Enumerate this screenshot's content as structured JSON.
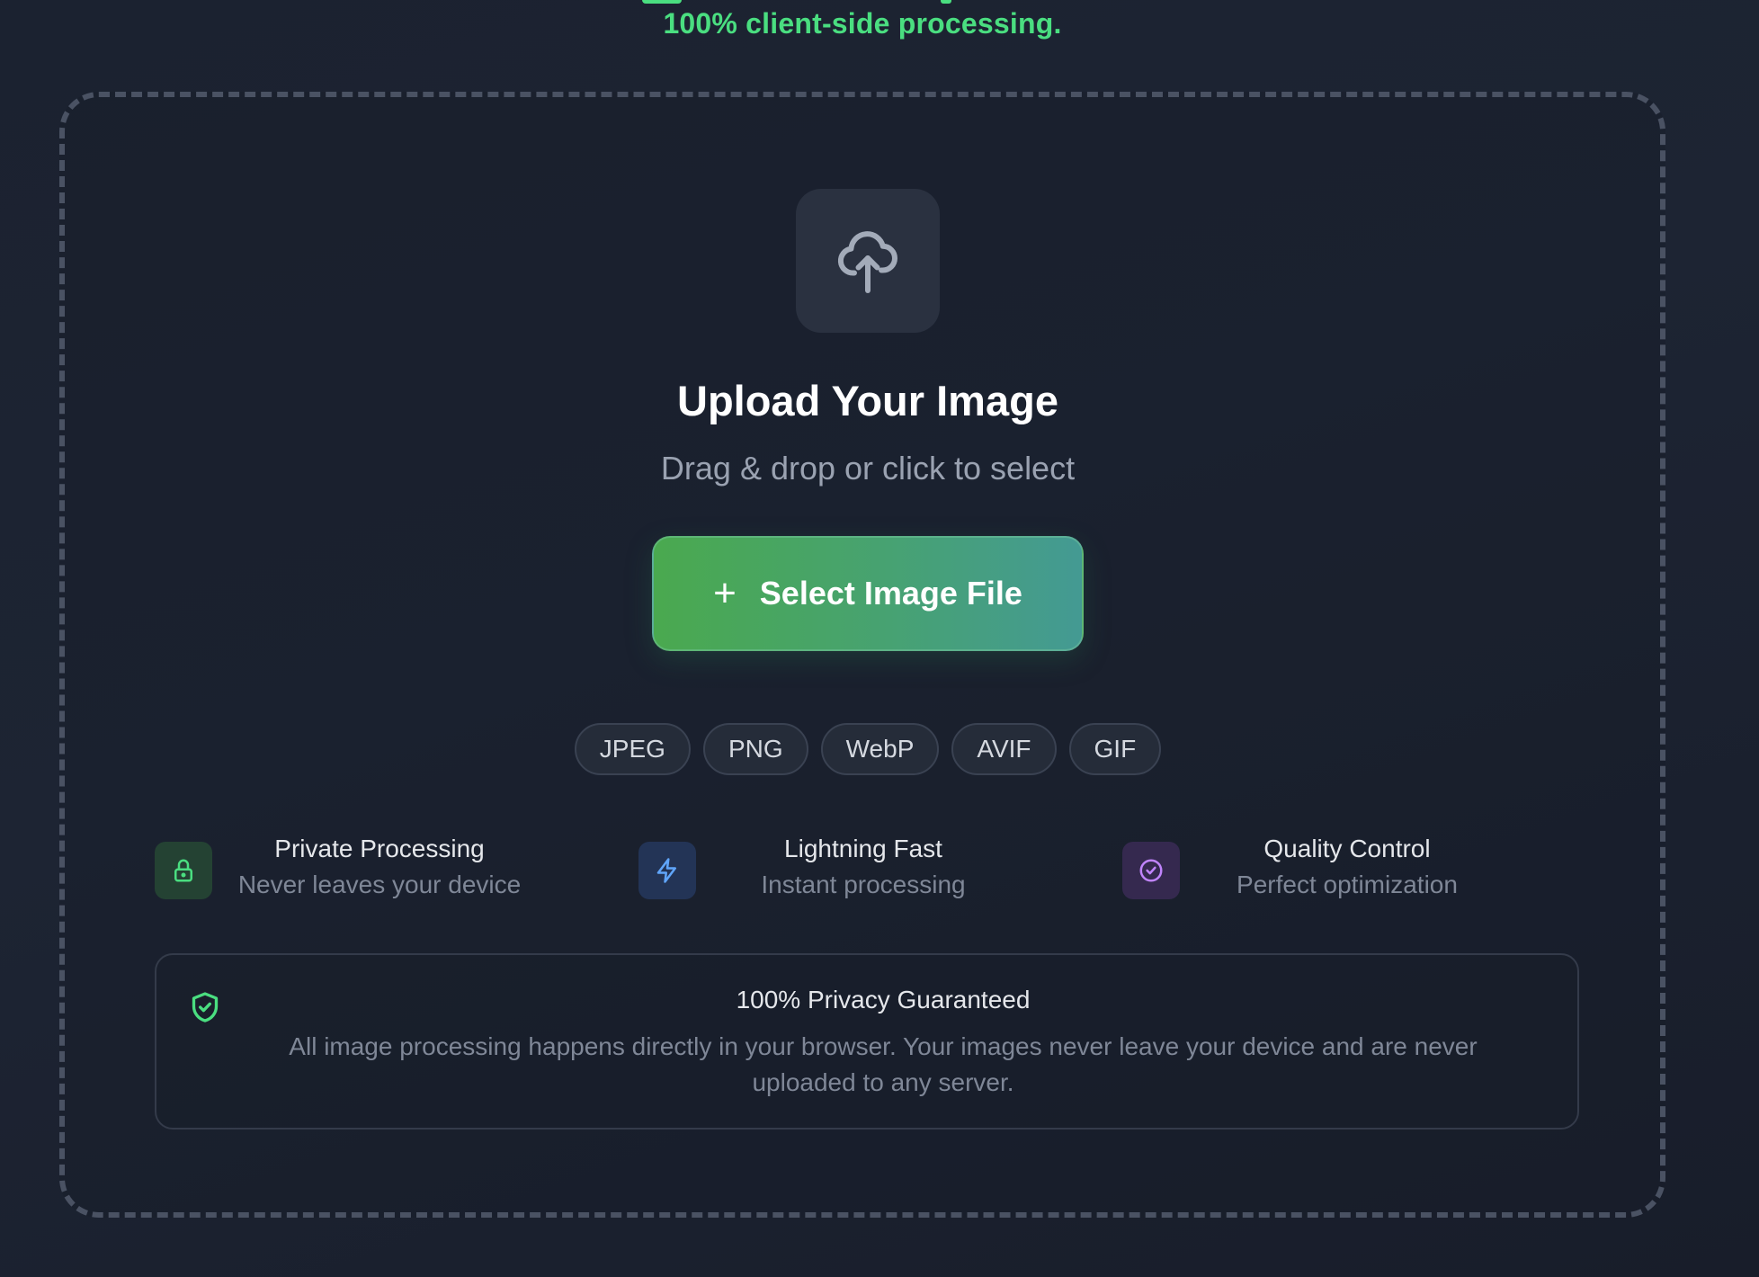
{
  "header": {
    "tagline": "100% client-side processing."
  },
  "upload": {
    "icon": "cloud-upload-icon",
    "title": "Upload Your Image",
    "subtitle": "Drag & drop or click to select",
    "button_icon": "plus-icon",
    "button_label": "Select Image File"
  },
  "formats": [
    "JPEG",
    "PNG",
    "WebP",
    "AVIF",
    "GIF"
  ],
  "features": [
    {
      "icon": "lock-icon",
      "title": "Private Processing",
      "description": "Never leaves your device",
      "accent": "#4ade80"
    },
    {
      "icon": "lightning-icon",
      "title": "Lightning Fast",
      "description": "Instant processing",
      "accent": "#60a5fa"
    },
    {
      "icon": "check-circle-icon",
      "title": "Quality Control",
      "description": "Perfect optimization",
      "accent": "#c084fc"
    }
  ],
  "privacy": {
    "icon": "shield-check-icon",
    "title": "100% Privacy Guaranteed",
    "description": "All image processing happens directly in your browser. Your images never leave your device and are never uploaded to any server."
  },
  "colors": {
    "accent_green": "#4ade80",
    "button_gradient_start": "#4aa94f",
    "button_gradient_end": "#449a93",
    "background": "#1d2433"
  }
}
